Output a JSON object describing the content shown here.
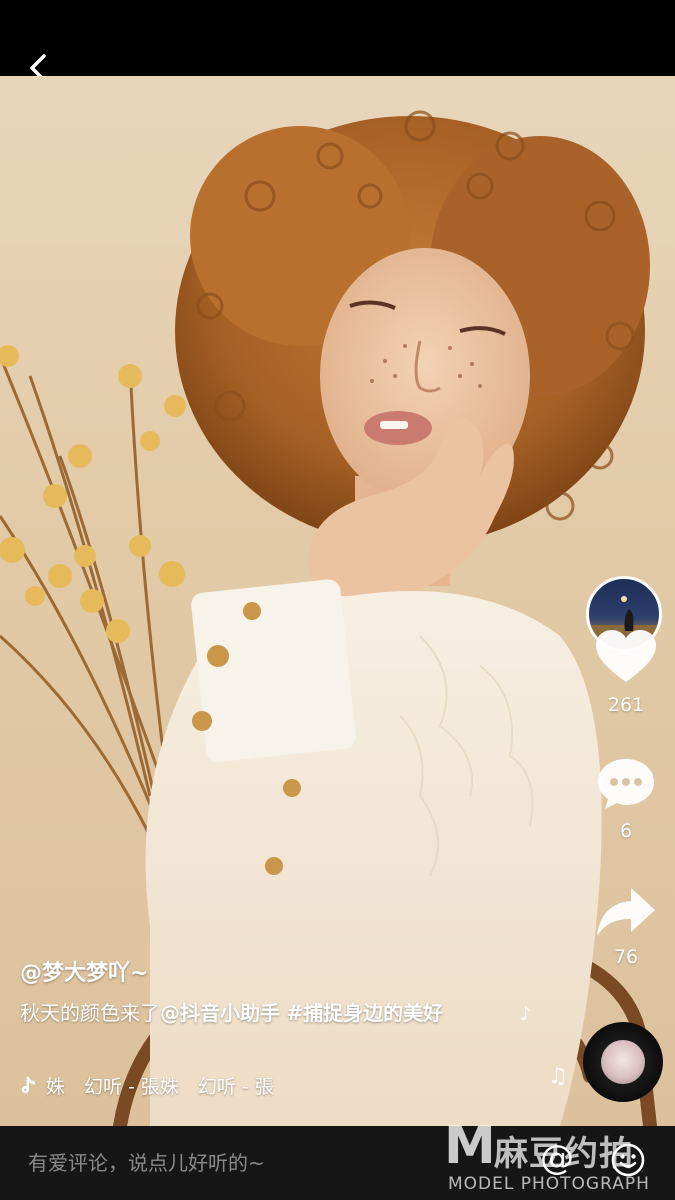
{
  "video": {
    "author": "@梦大梦吖~",
    "caption_text": "秋天的颜色来了",
    "mention": "@抖音小助手",
    "hashtag": "#捕捉身边的美好",
    "music_text": "姝　幻听 - 張姝　幻听 - 張"
  },
  "actions": {
    "likes": "261",
    "comments": "6",
    "shares": "76"
  },
  "icons": {
    "back": "back-arrow-icon",
    "music": "tiktok-note-icon",
    "like": "heart-icon",
    "comment": "comment-bubble-icon",
    "share": "share-arrow-icon",
    "mention": "at-icon",
    "emoji": "smiley-icon"
  },
  "comment_bar": {
    "placeholder": "有爱评论，说点儿好听的~",
    "at_symbol": "@"
  },
  "watermark": {
    "logo_letter": "M",
    "brand_cn": "麻豆约拍",
    "brand_en": "MODEL PHOTOGRAPH"
  },
  "colors": {
    "background": "#000000",
    "backdrop": "#e3cba8",
    "hair": "#b56a2a",
    "comment_bar": "#161616"
  }
}
